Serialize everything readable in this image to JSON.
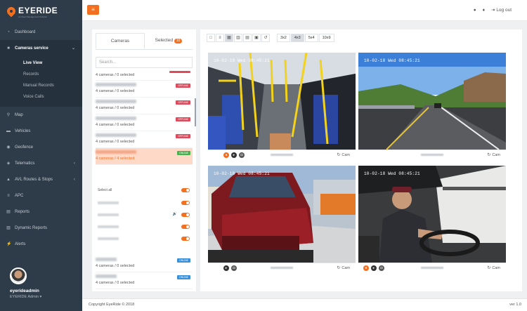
{
  "app": {
    "brand": "EYERIDE",
    "tagline": "An Fleet Management Solution"
  },
  "sidebar": {
    "items": [
      {
        "icon": "dashboard-icon",
        "label": "Dashboard"
      },
      {
        "icon": "camera-icon",
        "label": "Cameras service"
      },
      {
        "icon": "map-icon",
        "label": "Map"
      },
      {
        "icon": "vehicle-icon",
        "label": "Vehicles"
      },
      {
        "icon": "geofence-icon",
        "label": "Geofence"
      },
      {
        "icon": "telematics-icon",
        "label": "Telematics"
      },
      {
        "icon": "routes-icon",
        "label": "AVL Routes & Stops"
      },
      {
        "icon": "apc-icon",
        "label": "APC"
      },
      {
        "icon": "reports-icon",
        "label": "Reports"
      },
      {
        "icon": "dynamic-reports-icon",
        "label": "Dynamic Reports"
      },
      {
        "icon": "alerts-icon",
        "label": "Alerts"
      }
    ],
    "sub_items": [
      "Live View",
      "Records",
      "Manual Records",
      "Voice Calls"
    ]
  },
  "user": {
    "name": "eyerideadmin",
    "role": "EYERIDE Admin ▾"
  },
  "topbar": {
    "logout": "Log out"
  },
  "panel": {
    "tab_cameras": "Cameras",
    "tab_selected": "Selected",
    "selected_count": "10",
    "search_placeholder": "Search...",
    "rows": [
      {
        "status": "4 cameras / 0 selected",
        "tag": "",
        "tag_color": "#e0495a"
      },
      {
        "status": "4 cameras / 0 selected",
        "tag": "OFFLINE",
        "tag_color": "#e0495a"
      },
      {
        "status": "4 cameras / 0 selected",
        "tag": "OFFLINE",
        "tag_color": "#e0495a"
      },
      {
        "status": "4 cameras / 0 selected",
        "tag": "OFFLINE",
        "tag_color": "#e0495a"
      },
      {
        "status": "4 cameras / 0 selected",
        "tag": "OFFLINE",
        "tag_color": "#e0495a"
      },
      {
        "status": "4 cameras / 4 selected",
        "tag": "ONLINE",
        "tag_color": "#4caf50"
      }
    ],
    "select_all": "Select all",
    "bottom_rows": [
      {
        "status": "4 cameras / 0 selected",
        "tag": "ONLINE",
        "tag_color": "#3a8fd6"
      },
      {
        "status": "4 cameras / 0 selected",
        "tag": "ONLINE",
        "tag_color": "#3a8fd6"
      }
    ]
  },
  "toolbar": {
    "layouts": [
      "3x2",
      "4x3",
      "5x4",
      "10x9"
    ],
    "active_layout": "4x3"
  },
  "cameras": [
    {
      "timestamp": "10-02-18  Wed 08:45:21",
      "label": "Cam"
    },
    {
      "timestamp": "10-02-18  Wed 08:45:21",
      "label": "Cam"
    },
    {
      "timestamp": "10-02-18  Wed 08:45:21",
      "label": "Cam"
    },
    {
      "timestamp": "10-02-18  Wed 08:45:21",
      "label": "Cam"
    }
  ],
  "footer": {
    "copyright": "Copyright EyeRide © 2018",
    "version": "ver 1.0"
  },
  "colors": {
    "accent": "#f37021",
    "sidebar": "#2e3b48"
  }
}
